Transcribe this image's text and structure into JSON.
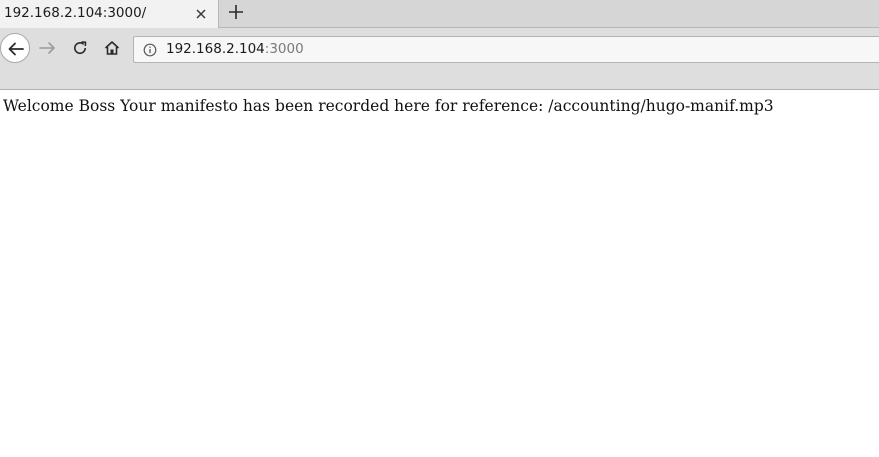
{
  "browser": {
    "tab": {
      "title": "192.168.2.104:3000/"
    },
    "address_bar": {
      "host": "192.168.2.104",
      "port": ":3000"
    }
  },
  "icons": {
    "back": "arrow-left-icon",
    "forward": "arrow-right-icon",
    "reload": "reload-icon",
    "home": "home-icon",
    "info": "info-icon",
    "close": "close-icon",
    "new_tab": "plus-icon"
  },
  "page": {
    "message": "Welcome Boss Your manifesto has been recorded here for reference: /accounting/hugo-manif.mp3"
  }
}
